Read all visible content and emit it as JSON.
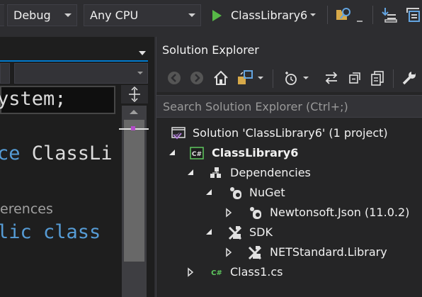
{
  "toolbar": {
    "configuration": "Debug",
    "platform": "Any CPU",
    "run_label": "ClassLibrary6"
  },
  "editor": {
    "code_lines": [
      "ystem;",
      "ce ClassLi",
      "lic class"
    ],
    "references_hint": "erences"
  },
  "solution_explorer": {
    "title": "Solution Explorer",
    "search_placeholder": "Search Solution Explorer (Ctrl+;)",
    "tree": {
      "solution": "Solution 'ClassLibrary6' (1 project)",
      "project": "ClassLibrary6",
      "project_badge": "C#",
      "dependencies": "Dependencies",
      "nuget": "NuGet",
      "newtonsoft": "Newtonsoft.Json (11.0.2)",
      "sdk": "SDK",
      "netstandard": "NETStandard.Library",
      "class1": "Class1.cs",
      "class1_badge": "C#"
    }
  },
  "colors": {
    "accent": "#007acc",
    "run_green": "#57b947",
    "keyword_blue": "#569cd6",
    "solution_purple": "#b180d7",
    "csharp_green": "#5ec75e"
  },
  "icons": [
    "play-icon",
    "find-in-files-icon",
    "back-icon",
    "forward-icon",
    "home-icon",
    "switch-views-icon",
    "pending-changes-icon",
    "sync-icon",
    "collapse-all-icon",
    "show-all-files-icon",
    "properties-wrench-icon",
    "solution-icon",
    "csharp-project-icon",
    "dependencies-icon",
    "nuget-icon",
    "package-icon",
    "sdk-icon",
    "csharp-file-icon"
  ]
}
